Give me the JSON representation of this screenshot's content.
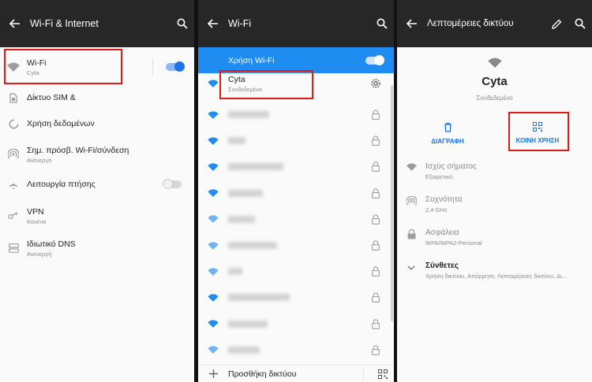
{
  "panel1": {
    "title": "Wi-Fi & Internet",
    "items": [
      {
        "label": "Wi-Fi",
        "sub": "Cyta"
      },
      {
        "label": "Δίκτυο SIM &",
        "sub": ""
      },
      {
        "label": "Χρήση δεδομένων",
        "sub": ""
      },
      {
        "label": "Σημ. πρόσβ. Wi-Fi/σύνδεση",
        "sub": "Ανενεργό"
      },
      {
        "label": "Λειτουργία πτήσης",
        "sub": ""
      },
      {
        "label": "VPN",
        "sub": "Κανένα"
      },
      {
        "label": "Ιδιωτικό DNS",
        "sub": "Ανενεργή"
      }
    ],
    "wifi_toggle": "on",
    "airplane_toggle": "off"
  },
  "panel2": {
    "title": "Wi-Fi",
    "use_wifi_label": "Χρήση Wi-Fi",
    "connected": {
      "name": "Cyta",
      "status": "Συνδεδεμένο"
    },
    "add_network_label": "Προσθήκη δικτύου"
  },
  "panel3": {
    "title": "Λεπτομέρειες δικτύου",
    "network_name": "Cyta",
    "network_status": "Συνδεδεμένο",
    "delete_label": "ΔΙΑΓΡΑΦΗ",
    "share_label": "ΚΟΙΝΗ ΧΡΗΣΗ",
    "details": [
      {
        "label": "Ισχύς σήματος",
        "sub": "Εξαιρετικό"
      },
      {
        "label": "Συχνότητα",
        "sub": "2,4 GHz"
      },
      {
        "label": "Ασφάλεια",
        "sub": "WPA/WPA2-Personal"
      },
      {
        "label": "Σύνθετες",
        "sub": "Χρήση δικτύου, Απόρρητο, Λεπτομέρειες δικτύου, Δι..."
      }
    ]
  },
  "colors": {
    "accent": "#1a73e8",
    "wifi_bar": "#1e8cf0",
    "appbar": "#272727",
    "highlight": "#e01818"
  }
}
